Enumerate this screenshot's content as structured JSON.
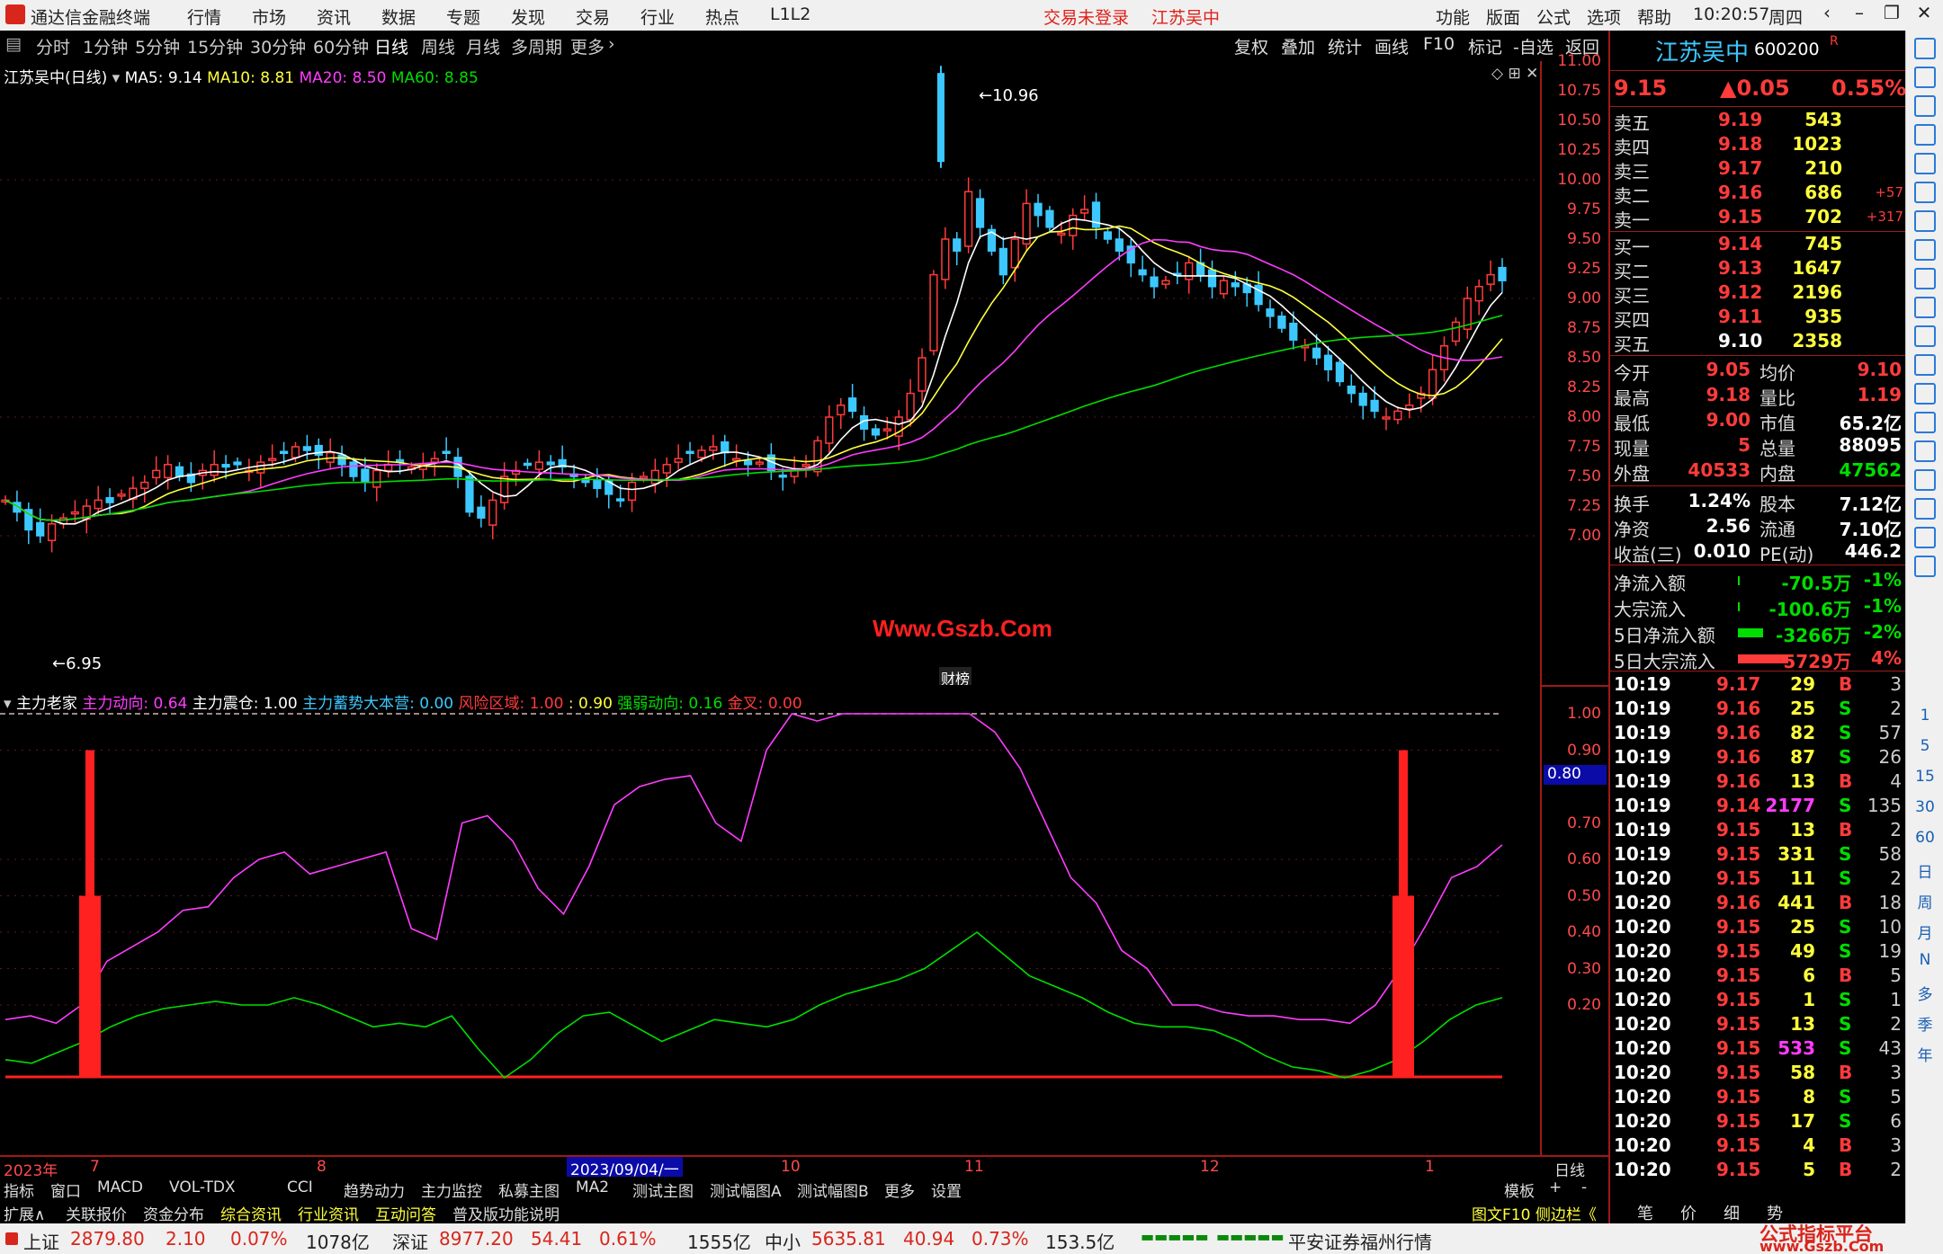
{
  "titlebar": {
    "app_name": "通达信金融终端",
    "menus": [
      "行情",
      "市场",
      "资讯",
      "数据",
      "专题",
      "发现",
      "交易",
      "行业",
      "热点",
      "L1L2"
    ],
    "trade_status": "交易未登录",
    "stock_title": "江苏吴中",
    "right_menus": [
      "功能",
      "版面",
      "公式",
      "选项",
      "帮助"
    ],
    "time": "10:20:57",
    "weekday": "周四"
  },
  "toolrow": {
    "timeframes": [
      "分时",
      "1分钟",
      "5分钟",
      "15分钟",
      "30分钟",
      "60分钟",
      "日线",
      "周线",
      "月线",
      "多周期",
      "更多"
    ],
    "active_timeframe": "日线",
    "buttons": [
      "复权",
      "叠加",
      "统计",
      "画线",
      "F10",
      "标记",
      "-自选",
      "返回"
    ]
  },
  "chart": {
    "label": "江苏吴中(日线)",
    "ma": [
      {
        "name": "MA5",
        "value": "9.14",
        "color": "#ffffff"
      },
      {
        "name": "MA10",
        "value": "8.81",
        "color": "#ffff3c"
      },
      {
        "name": "MA20",
        "value": "8.50",
        "color": "#ff3cff"
      },
      {
        "name": "MA60",
        "value": "8.85",
        "color": "#00dd00"
      }
    ],
    "high_marker": "10.96",
    "low_marker": "6.95",
    "watermark": "Www.Gszb.Com",
    "badge": "财榜",
    "y_ticks": [
      "11.00",
      "10.75",
      "10.50",
      "10.25",
      "10.00",
      "9.75",
      "9.50",
      "9.25",
      "9.00",
      "8.75",
      "8.50",
      "8.25",
      "8.00",
      "7.75",
      "7.50",
      "7.25",
      "7.00"
    ]
  },
  "indicator": {
    "name": "主力老家",
    "items": [
      {
        "label": "主力动向: 0.64",
        "color": "#ff3cff"
      },
      {
        "label": "主力震仓: 1.00",
        "color": "#ffffff"
      },
      {
        "label": "主力蓄势大本营: 0.00",
        "color": "#3cc8ff"
      },
      {
        "label": "风险区域: 1.00",
        "color": "#ff3b3b"
      },
      {
        "label": ": 0.90",
        "color": "#ffff3c"
      },
      {
        "label": "强弱动向: 0.16",
        "color": "#00dd00"
      },
      {
        "label": "金叉: 0.00",
        "color": "#ff3b3b"
      }
    ],
    "y_ticks": [
      "1.00",
      "0.90",
      "0.70",
      "0.60",
      "0.50",
      "0.40",
      "0.30",
      "0.20"
    ],
    "current_tag": "0.80"
  },
  "dates": [
    "2023年",
    "7",
    "8",
    "2023/09/04/一",
    "10",
    "11",
    "12",
    "1"
  ],
  "axis_period": "日线",
  "tabs1": [
    "指标",
    "窗口",
    "MACD",
    "VOL-TDX",
    "CCI",
    "趋势动力",
    "主力监控",
    "私募主图",
    "MA2",
    "测试主图",
    "测试幅图A",
    "测试幅图B",
    "更多",
    "设置"
  ],
  "tabs1_right": [
    "模板",
    "+",
    "-"
  ],
  "tabs2": [
    {
      "label": "扩展∧",
      "color": "#dddddd"
    },
    {
      "label": "关联报价",
      "color": "#dddddd"
    },
    {
      "label": "资金分布",
      "color": "#dddddd"
    },
    {
      "label": "综合资讯",
      "color": "#ffff3c"
    },
    {
      "label": "行业资讯",
      "color": "#ffff3c"
    },
    {
      "label": "互动问答",
      "color": "#ffff3c"
    },
    {
      "label": "普及版功能说明",
      "color": "#dddddd"
    }
  ],
  "tabs2_right": "图文F10 侧边栏《",
  "quote": {
    "name": "江苏吴中",
    "code": "600200",
    "r_mark": "R",
    "price": "9.15",
    "change": "▲0.05",
    "pct": "0.55%",
    "asks": [
      {
        "label": "卖五",
        "price": "9.19",
        "vol": "543",
        "delta": ""
      },
      {
        "label": "卖四",
        "price": "9.18",
        "vol": "1023",
        "delta": ""
      },
      {
        "label": "卖三",
        "price": "9.17",
        "vol": "210",
        "delta": ""
      },
      {
        "label": "卖二",
        "price": "9.16",
        "vol": "686",
        "delta": "+57"
      },
      {
        "label": "卖一",
        "price": "9.15",
        "vol": "702",
        "delta": "+317"
      }
    ],
    "bids": [
      {
        "label": "买一",
        "price": "9.14",
        "vol": "745"
      },
      {
        "label": "买二",
        "price": "9.13",
        "vol": "1647"
      },
      {
        "label": "买三",
        "price": "9.12",
        "vol": "2196"
      },
      {
        "label": "买四",
        "price": "9.11",
        "vol": "935"
      },
      {
        "label": "买五",
        "price": "9.10",
        "vol": "2358"
      }
    ],
    "stats": [
      {
        "l1": "今开",
        "v1": "9.05",
        "c1": "red",
        "l2": "均价",
        "v2": "9.10",
        "c2": "red"
      },
      {
        "l1": "最高",
        "v1": "9.18",
        "c1": "red",
        "l2": "量比",
        "v2": "1.19",
        "c2": "red"
      },
      {
        "l1": "最低",
        "v1": "9.00",
        "c1": "red",
        "l2": "市值",
        "v2": "65.2亿",
        "c2": "white"
      },
      {
        "l1": "现量",
        "v1": "5",
        "c1": "red",
        "l2": "总量",
        "v2": "88095",
        "c2": "white"
      },
      {
        "l1": "外盘",
        "v1": "40533",
        "c1": "red",
        "l2": "内盘",
        "v2": "47562",
        "c2": "green"
      }
    ],
    "stats2": [
      {
        "l1": "换手",
        "v1": "1.24%",
        "l2": "股本",
        "v2": "7.12亿"
      },
      {
        "l1": "净资",
        "v1": "2.56",
        "l2": "流通",
        "v2": "7.10亿"
      },
      {
        "l1": "收益(三)",
        "v1": "0.010",
        "l2": "PE(动)",
        "v2": "446.2"
      }
    ],
    "flows": [
      {
        "label": "净流入额",
        "value": "-70.5万",
        "pct": "-1%",
        "color": "green",
        "bar": 0.02
      },
      {
        "label": "大宗流入",
        "value": "-100.6万",
        "pct": "-1%",
        "color": "green",
        "bar": 0.02
      },
      {
        "label": "5日净流入额",
        "value": "-3266万",
        "pct": "-2%",
        "color": "green",
        "bar": 0.5
      },
      {
        "label": "5日大宗流入",
        "value": "5729万",
        "pct": "4%",
        "color": "red",
        "bar": 1.0
      }
    ],
    "ticks": [
      {
        "t": "10:19",
        "p": "9.17",
        "v": "29",
        "s": "B",
        "n": "3",
        "vc": "yellow"
      },
      {
        "t": "10:19",
        "p": "9.16",
        "v": "25",
        "s": "S",
        "n": "2",
        "vc": "yellow"
      },
      {
        "t": "10:19",
        "p": "9.16",
        "v": "82",
        "s": "S",
        "n": "57",
        "vc": "yellow"
      },
      {
        "t": "10:19",
        "p": "9.16",
        "v": "87",
        "s": "S",
        "n": "26",
        "vc": "yellow"
      },
      {
        "t": "10:19",
        "p": "9.16",
        "v": "13",
        "s": "B",
        "n": "4",
        "vc": "yellow"
      },
      {
        "t": "10:19",
        "p": "9.14",
        "v": "2177",
        "s": "S",
        "n": "135",
        "vc": "magenta"
      },
      {
        "t": "10:19",
        "p": "9.15",
        "v": "13",
        "s": "B",
        "n": "2",
        "vc": "yellow"
      },
      {
        "t": "10:19",
        "p": "9.15",
        "v": "331",
        "s": "S",
        "n": "58",
        "vc": "yellow"
      },
      {
        "t": "10:20",
        "p": "9.15",
        "v": "11",
        "s": "S",
        "n": "2",
        "vc": "yellow"
      },
      {
        "t": "10:20",
        "p": "9.16",
        "v": "441",
        "s": "B",
        "n": "18",
        "vc": "yellow"
      },
      {
        "t": "10:20",
        "p": "9.15",
        "v": "25",
        "s": "S",
        "n": "10",
        "vc": "yellow"
      },
      {
        "t": "10:20",
        "p": "9.15",
        "v": "49",
        "s": "S",
        "n": "19",
        "vc": "yellow"
      },
      {
        "t": "10:20",
        "p": "9.15",
        "v": "6",
        "s": "B",
        "n": "5",
        "vc": "yellow"
      },
      {
        "t": "10:20",
        "p": "9.15",
        "v": "1",
        "s": "S",
        "n": "1",
        "vc": "yellow"
      },
      {
        "t": "10:20",
        "p": "9.15",
        "v": "13",
        "s": "S",
        "n": "2",
        "vc": "yellow"
      },
      {
        "t": "10:20",
        "p": "9.15",
        "v": "533",
        "s": "S",
        "n": "43",
        "vc": "magenta"
      },
      {
        "t": "10:20",
        "p": "9.15",
        "v": "58",
        "s": "B",
        "n": "3",
        "vc": "yellow"
      },
      {
        "t": "10:20",
        "p": "9.15",
        "v": "8",
        "s": "S",
        "n": "5",
        "vc": "yellow"
      },
      {
        "t": "10:20",
        "p": "9.15",
        "v": "17",
        "s": "S",
        "n": "6",
        "vc": "yellow"
      },
      {
        "t": "10:20",
        "p": "9.15",
        "v": "4",
        "s": "B",
        "n": "3",
        "vc": "yellow"
      },
      {
        "t": "10:20",
        "p": "9.15",
        "v": "5",
        "s": "B",
        "n": "2",
        "vc": "yellow"
      }
    ],
    "bottom_tabs": [
      "笔",
      "价",
      "细",
      "势"
    ]
  },
  "sidebar_labels": [
    "1",
    "5",
    "15",
    "30",
    "60",
    "日",
    "周",
    "月",
    "N",
    "多",
    "季",
    "年"
  ],
  "status": {
    "sh_label": "上证",
    "sh_value": "2879.80",
    "sh_change": "2.10",
    "sh_pct": "0.07%",
    "sh_amount": "1078亿",
    "sz_label": "深证",
    "sz_value": "8977.20",
    "sz_change": "54.41",
    "sz_pct": "0.61%",
    "sz_amount": "1555亿",
    "zx_label": "中小",
    "zx_value": "5635.81",
    "zx_change": "40.94",
    "zx_pct": "0.73%",
    "zx_amount": "153.5亿",
    "broker": "平安证券福州行情",
    "brand": "公式指标平台",
    "brand_url": "www.Gszb.Com"
  },
  "colors": {
    "up": "#ff3b3b",
    "down": "#00dd00",
    "accent": "#a0191a",
    "ma5": "#ffffff",
    "ma10": "#ffff3c",
    "ma20": "#ff3cff",
    "ma60": "#00dd00",
    "candle_down": "#3cc8ff"
  }
}
